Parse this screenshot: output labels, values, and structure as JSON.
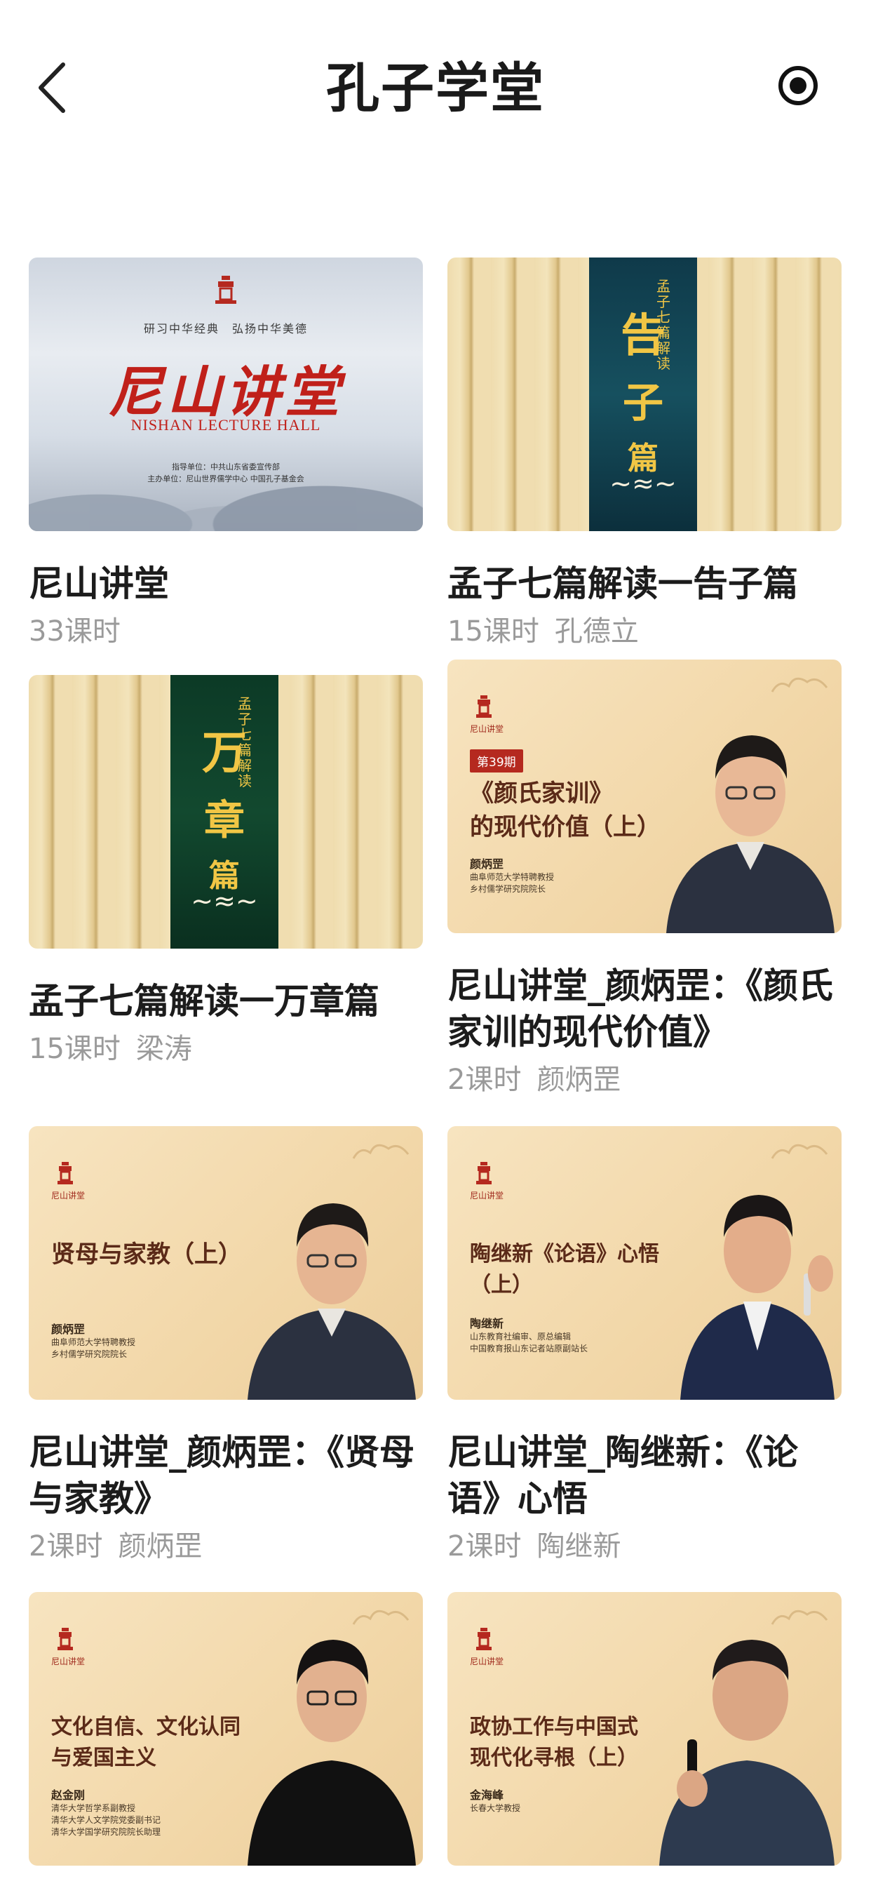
{
  "header": {
    "title": "孔子学堂",
    "back_icon": "chevron-left-icon",
    "record_icon": "radio-record-icon"
  },
  "courses": [
    {
      "title": "尼山讲堂",
      "lessons": "33课时",
      "teacher": "",
      "thumb": {
        "slogan": "研习中华经典　弘扬中华美德",
        "calligraphy": "尼山讲堂",
        "english": "NISHAN LECTURE HALL",
        "org1": "指导单位：中共山东省委宣传部",
        "org2": "主办单位：尼山世界儒学中心 中国孔子基金会"
      }
    },
    {
      "title": "孟子七篇解读一告子篇",
      "lessons": "15课时",
      "teacher": "孔德立",
      "thumb": {
        "chars": [
          "告",
          "子",
          "篇"
        ],
        "tag": "孟子七篇解读"
      }
    },
    {
      "title": "孟子七篇解读一万章篇",
      "lessons": "15课时",
      "teacher": "梁涛",
      "thumb": {
        "chars": [
          "万",
          "章",
          "篇"
        ],
        "tag": "孟子七篇解读"
      }
    },
    {
      "title": "尼山讲堂_颜炳罡：《颜氏家训的现代价值》",
      "lessons": "2课时",
      "teacher": "颜炳罡",
      "thumb": {
        "logo": "尼山讲堂",
        "badge": "第39期",
        "line1": "《颜氏家训》",
        "line2": "的现代价值（上）",
        "name": "颜炳罡",
        "desc1": "曲阜师范大学特聘教授",
        "desc2": "乡村儒学研究院院长"
      }
    },
    {
      "title": "尼山讲堂_颜炳罡：《贤母与家教》",
      "lessons": "2课时",
      "teacher": "颜炳罡",
      "thumb": {
        "logo": "尼山讲堂",
        "line1": "贤母与家教（上）",
        "line2": "",
        "name": "颜炳罡",
        "desc1": "曲阜师范大学特聘教授",
        "desc2": "乡村儒学研究院院长"
      }
    },
    {
      "title": "尼山讲堂_陶继新：《论语》心悟",
      "lessons": "2课时",
      "teacher": "陶继新",
      "thumb": {
        "logo": "尼山讲堂",
        "line1": "陶继新《论语》心悟",
        "line2": "（上）",
        "name": "陶继新",
        "desc1": "山东教育社编审、原总编辑",
        "desc2": "中国教育报山东记者站原副站长"
      }
    },
    {
      "title": "",
      "lessons": "",
      "teacher": "",
      "thumb": {
        "logo": "尼山讲堂",
        "line1": "文化自信、文化认同",
        "line2": "与爱国主义",
        "name": "赵金刚",
        "desc1": "清华大学哲学系副教授",
        "desc2": "清华大学人文学院党委副书记",
        "desc3": "清华大学国学研究院院长助理"
      }
    },
    {
      "title": "",
      "lessons": "",
      "teacher": "",
      "thumb": {
        "logo": "尼山讲堂",
        "line1": "政协工作与中国式",
        "line2": "现代化寻根（上）",
        "name": "金海峰",
        "desc1": "长春大学教授"
      }
    }
  ]
}
